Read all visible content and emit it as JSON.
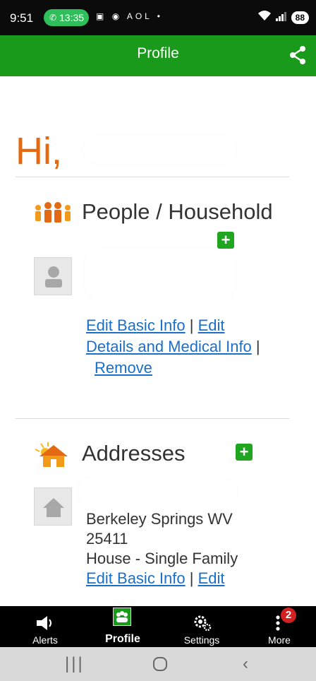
{
  "status_bar": {
    "time": "9:51",
    "call_timer": "13:35",
    "notif_text": "AOL",
    "battery": "88"
  },
  "header": {
    "title": "Profile"
  },
  "greeting": {
    "prefix": "Hi,"
  },
  "people": {
    "title": "People / Household",
    "links": {
      "edit_basic": "Edit Basic Info",
      "sep1": " | ",
      "edit": "Edit",
      "details": "Details and Medical Info",
      "sep2": " |",
      "remove": "Remove"
    }
  },
  "addresses": {
    "title": "Addresses",
    "line_city": "Berkeley Springs WV",
    "line_zip": "25411",
    "line_type": "House - Single Family",
    "edit_basic": "Edit Basic Info",
    "sep": "  | ",
    "edit": "Edit"
  },
  "bottom_nav": {
    "items": [
      {
        "label": "Alerts",
        "icon": "megaphone-icon"
      },
      {
        "label": "Profile",
        "icon": "people-icon"
      },
      {
        "label": "Settings",
        "icon": "gears-icon"
      },
      {
        "label": "More",
        "icon": "kebab-icon"
      }
    ],
    "more_badge": "2"
  },
  "colors": {
    "accent_green": "#1a9a1a",
    "greeting_orange": "#e36a12",
    "link_blue": "#1a6fc8",
    "badge_red": "#d32020"
  }
}
